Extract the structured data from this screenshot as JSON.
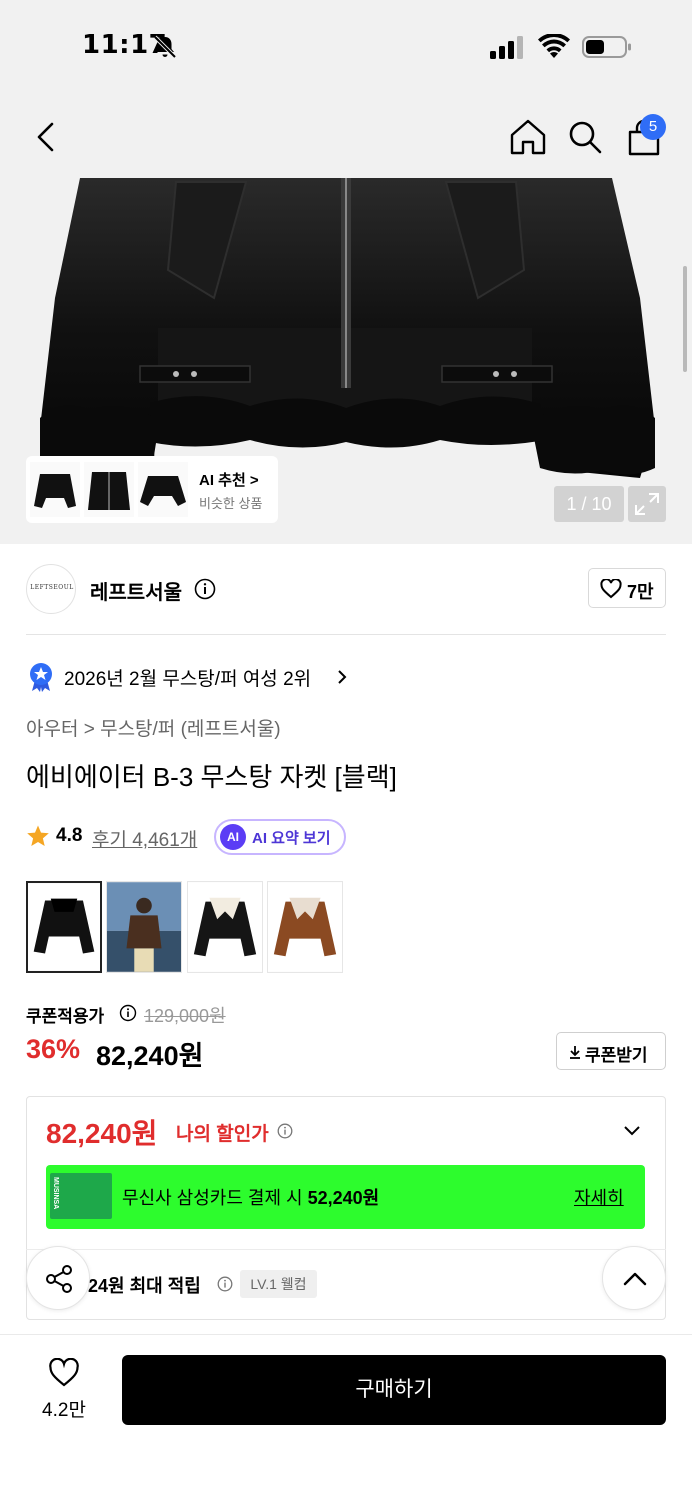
{
  "status_bar": {
    "time": "11:17"
  },
  "header": {
    "cart_count": "5"
  },
  "gallery": {
    "ai_recommend": {
      "title": "AI 추천 >",
      "subtitle": "비슷한 상품"
    },
    "counter": "1 / 10"
  },
  "brand": {
    "logo_text": "LEFTSEOUL",
    "name": "레프트서울",
    "likes": "7만"
  },
  "ranking": {
    "text": "2026년 2월 무스탕/퍼 여성 2위"
  },
  "breadcrumb": "아우터 > 무스탕/퍼 (레프트서울)",
  "product": {
    "title": "에비에이터 B-3 무스탕 자켓 [블랙]",
    "rating": "4.8",
    "reviews": "후기 4,461개",
    "ai_summary": {
      "badge": "AI",
      "label": "AI 요약 보기"
    }
  },
  "price": {
    "coupon_label": "쿠폰적용가",
    "original": "129,000원",
    "discount": "36%",
    "sale": "82,240원",
    "coupon_button": "쿠폰받기"
  },
  "benefits": {
    "my_price": "82,240원",
    "my_price_label": "나의 할인가",
    "promo_card_text": "MUSINSA",
    "promo_prefix": "무신사 삼성카드 결제 시 ",
    "promo_price": "52,240원",
    "promo_link": "자세히",
    "points": "24원 최대 적립",
    "level": "LV.1 웰컴"
  },
  "bottom": {
    "wish_count": "4.2만",
    "buy_label": "구매하기"
  },
  "colors": {
    "accent_red": "#e02d2d",
    "promo_green": "#2dfc2d",
    "badge_blue": "#2f6df6",
    "ai_purple": "#5b3df5"
  }
}
